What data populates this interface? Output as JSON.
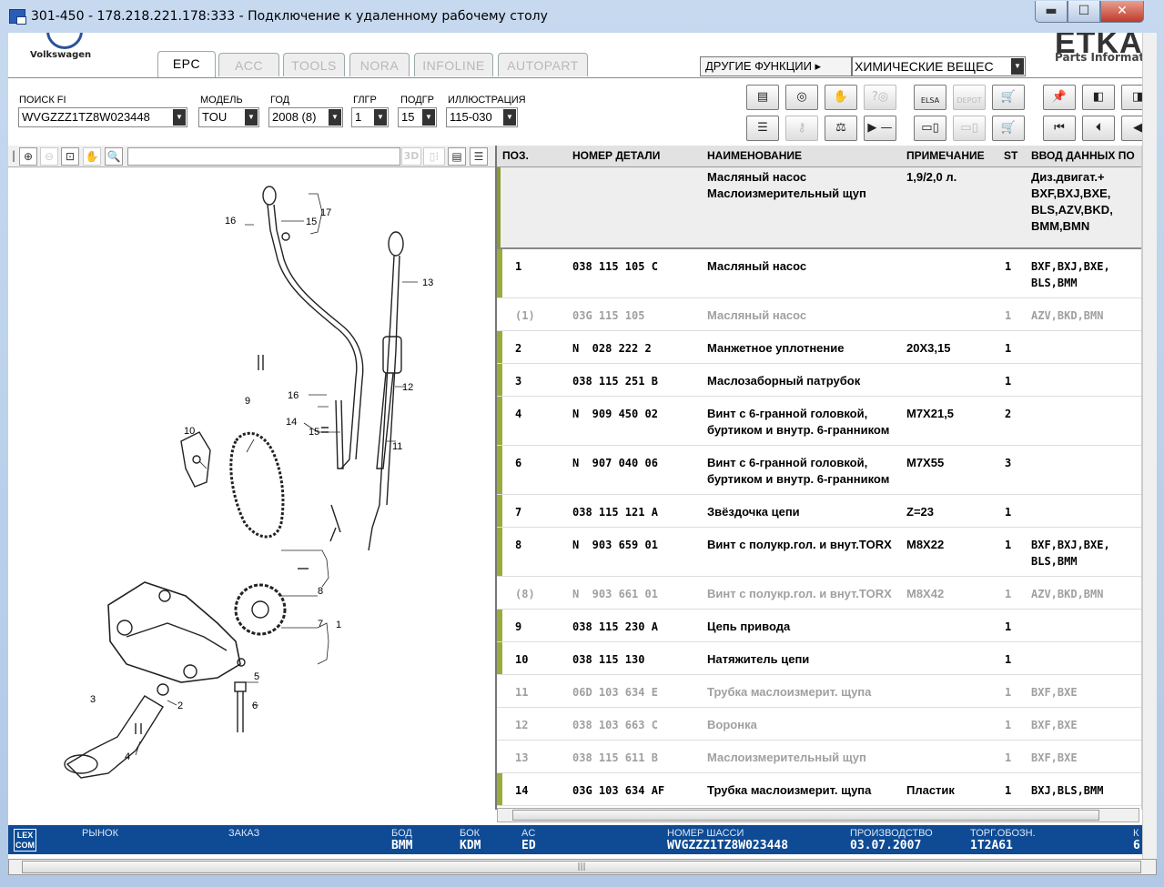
{
  "window": {
    "title": "301-450 - 178.218.221.178:333 - Подключение к удаленному рабочему столу",
    "min": "▬",
    "max": "☐",
    "close": "✕"
  },
  "header": {
    "brand": "Volkswagen",
    "tabs": [
      "EPC",
      "ACC",
      "TOOLS",
      "NORA",
      "INFOLINE",
      "AUTOPART"
    ],
    "other_functions": "ДРУГИЕ ФУНКЦИИ ▸",
    "chem_select": "ХИМИЧЕСКИЕ ВЕЩЕС",
    "etka": "ETKA",
    "etka_sub": "Parts Informat"
  },
  "search": {
    "fi_label": "ПОИСК FI",
    "fi_value": "WVGZZZ1TZ8W023448",
    "model_label": "МОДЕЛЬ",
    "model_value": "TOU",
    "year_label": "ГОД",
    "year_value": "2008 (8)",
    "glgr_label": "ГЛГР",
    "glgr_value": "1",
    "podgr_label": "ПОДГР",
    "podgr_value": "15",
    "illus_label": "ИЛЛЮСТРАЦИЯ",
    "illus_value": "115-030"
  },
  "toolbar": {
    "elsa": "ELSA",
    "depot": "DEPOT",
    "three_d": "3D"
  },
  "table": {
    "headers": {
      "pos": "ПОЗ.",
      "part": "НОМЕР ДЕТАЛИ",
      "name": "НАИМЕНОВАНИЕ",
      "note": "ПРИМЕЧАНИЕ",
      "st": "ST",
      "input": "ВВОД ДАННЫХ ПО"
    },
    "header_row": {
      "name": "Масляный насос\nМаслоизмерительный щуп",
      "note": "1,9/2,0 л.",
      "input": "Диз.двигат.+\nBXF,BXJ,BXE,\nBLS,AZV,BKD,\nBMM,BMN"
    },
    "rows": [
      {
        "pos": "1",
        "part": "038 115 105 C",
        "name": "Масляный насос",
        "note": "",
        "st": "1",
        "input": "BXF,BXJ,BXE,\nBLS,BMM",
        "grey": false
      },
      {
        "pos": "(1)",
        "part": "03G 115 105",
        "name": "Масляный насос",
        "note": "",
        "st": "1",
        "input": "AZV,BKD,BMN",
        "grey": true
      },
      {
        "pos": "2",
        "part": "N  028 222 2",
        "name": "Манжетное уплотнение",
        "note": "20X3,15",
        "st": "1",
        "input": "",
        "grey": false
      },
      {
        "pos": "3",
        "part": "038 115 251 B",
        "name": "Маслозаборный патрубок",
        "note": "",
        "st": "1",
        "input": "",
        "grey": false
      },
      {
        "pos": "4",
        "part": "N  909 450 02",
        "name": "Винт с 6-гранной головкой,\nбуртиком и внутр. 6-гранником",
        "note": "M7X21,5",
        "st": "2",
        "input": "",
        "grey": false
      },
      {
        "pos": "6",
        "part": "N  907 040 06",
        "name": "Винт с 6-гранной головкой,\nбуртиком и внутр. 6-гранником",
        "note": "M7X55",
        "st": "3",
        "input": "",
        "grey": false
      },
      {
        "pos": "7",
        "part": "038 115 121 A",
        "name": "Звёздочка цепи",
        "note": "Z=23",
        "st": "1",
        "input": "",
        "grey": false
      },
      {
        "pos": "8",
        "part": "N  903 659 01",
        "name": "Винт с полукр.гол. и внут.TORX",
        "note": "M8X22",
        "st": "1",
        "input": "BXF,BXJ,BXE,\nBLS,BMM",
        "grey": false
      },
      {
        "pos": "(8)",
        "part": "N  903 661 01",
        "name": "Винт с полукр.гол. и внут.TORX",
        "note": "M8X42",
        "st": "1",
        "input": "AZV,BKD,BMN",
        "grey": true
      },
      {
        "pos": "9",
        "part": "038 115 230 A",
        "name": "Цепь привода",
        "note": "",
        "st": "1",
        "input": "",
        "grey": false
      },
      {
        "pos": "10",
        "part": "038 115 130",
        "name": "Натяжитель цепи",
        "note": "",
        "st": "1",
        "input": "",
        "grey": false
      },
      {
        "pos": "11",
        "part": "06D 103 634 E",
        "name": "Трубка маслоизмерит. щупа",
        "note": "",
        "st": "1",
        "input": "BXF,BXE",
        "grey": true
      },
      {
        "pos": "12",
        "part": "038 103 663 C",
        "name": "Воронка",
        "note": "",
        "st": "1",
        "input": "BXF,BXE",
        "grey": true
      },
      {
        "pos": "13",
        "part": "038 115 611 B",
        "name": "Маслоизмерительный щуп",
        "note": "",
        "st": "1",
        "input": "BXF,BXE",
        "grey": true
      },
      {
        "pos": "14",
        "part": "03G 103 634 AF",
        "name": "Трубка маслоизмерит. щупа",
        "note": "Пластик",
        "st": "1",
        "input": "BXJ,BLS,BMM",
        "grey": false
      }
    ]
  },
  "illustration_labels": [
    "16",
    "15",
    "17",
    "13",
    "16",
    "12",
    "9",
    "10",
    "14",
    "15",
    "11",
    "8",
    "7",
    "1",
    "5",
    "2",
    "3",
    "6",
    "4"
  ],
  "status": {
    "lexcom": "LEX\nCOM",
    "market_label": "РЫНОК",
    "order_label": "ЗАКАЗ",
    "bod_label": "БОД",
    "bod_value": "BMM",
    "bok_label": "БОК",
    "bok_value": "KDM",
    "ac_label": "AC",
    "ac_value": "ED",
    "chassis_label": "НОМЕР ШАССИ",
    "chassis_value": "WVGZZZ1TZ8W023448",
    "prod_label": "ПРОИЗВОДСТВО",
    "prod_value": "03.07.2007",
    "torg_label": "ТОРГ.ОБОЗН.",
    "torg_value": "1T2A61",
    "k_label": "К",
    "k_value": "6"
  },
  "colors": {
    "status_bg": "#0f4b94",
    "row_marker": "#98ab3c",
    "tab_border": "#99aaaa"
  }
}
